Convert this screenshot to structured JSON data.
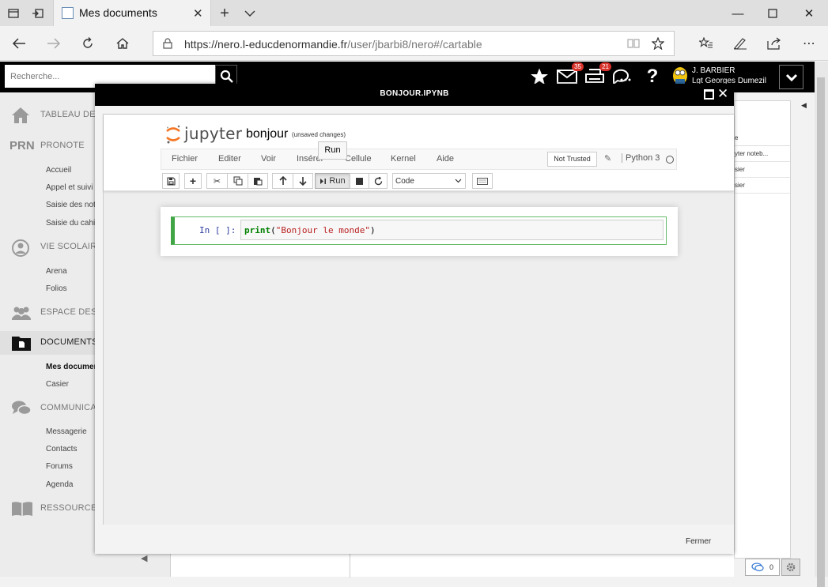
{
  "browser": {
    "tab_title": "Mes documents",
    "url_main": "https://nero.l-educdenormandie.fr",
    "url_path": "/user/jbarbi8/nero#/cartable"
  },
  "ent": {
    "search_placeholder": "Recherche...",
    "mail_badge": "35",
    "print_badge": "21",
    "user_name": "J. BARBIER",
    "school": "Lgt Georges Dumezil"
  },
  "sidebar": {
    "tableau": "TABLEAU DE B",
    "prn_logo": "PRN",
    "pronote": "PRONOTE",
    "pronote_items": [
      "Accueil",
      "Appel et suivi",
      "Saisie des not",
      "Saisie du cahi"
    ],
    "vie_scolaire": "VIE SCOLAIRE",
    "vie_items": [
      "Arena",
      "Folios"
    ],
    "espace": "ESPACE DES C",
    "documents": "DOCUMENTS",
    "doc_items": [
      "Mes documen",
      "Casier"
    ],
    "communication": "COMMUNICAT",
    "comm_items": [
      "Messagerie",
      "Contacts",
      "Forums",
      "Agenda"
    ],
    "ressources": "RESSOURCES"
  },
  "right_panel": {
    "header": "e",
    "rows": [
      "yter noteb...",
      "sier",
      "sier"
    ]
  },
  "chat_count": "0",
  "modal": {
    "title": "BONJOUR.IPYNB",
    "close_label": "Fermer"
  },
  "jupyter": {
    "logo_text": "jupyter",
    "notebook_name": "bonjour",
    "save_status": "(unsaved changes)",
    "tooltip": "Run",
    "menu": [
      "Fichier",
      "Editer",
      "Voir",
      "Insérer",
      "Cellule",
      "Kernel",
      "Aide"
    ],
    "trust": "Not Trusted",
    "kernel": "Python 3",
    "run_label": "Run",
    "cell_type": "Code",
    "prompt": "In [ ]:",
    "code": {
      "fn": "print",
      "open": "(",
      "str": "\"Bonjour le monde\"",
      "close": ")"
    }
  }
}
